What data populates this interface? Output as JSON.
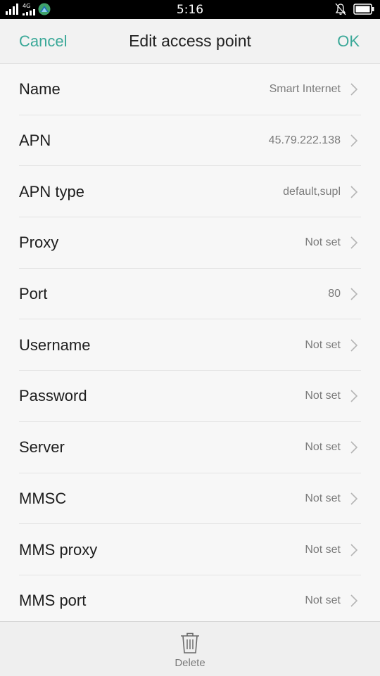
{
  "status_bar": {
    "time": "5:16",
    "network_label": "4G",
    "battery_icon": "battery-icon",
    "notif_icon": "bell-off-icon"
  },
  "header": {
    "cancel_label": "Cancel",
    "title": "Edit access point",
    "ok_label": "OK",
    "accent_color": "#3aa898"
  },
  "fields": [
    {
      "label": "Name",
      "value": "Smart Internet"
    },
    {
      "label": "APN",
      "value": "45.79.222.138"
    },
    {
      "label": "APN type",
      "value": "default,supl"
    },
    {
      "label": "Proxy",
      "value": "Not set"
    },
    {
      "label": "Port",
      "value": "80"
    },
    {
      "label": "Username",
      "value": "Not set"
    },
    {
      "label": "Password",
      "value": "Not set"
    },
    {
      "label": "Server",
      "value": "Not set"
    },
    {
      "label": "MMSC",
      "value": "Not set"
    },
    {
      "label": "MMS proxy",
      "value": "Not set"
    },
    {
      "label": "MMS port",
      "value": "Not set"
    }
  ],
  "bottom_bar": {
    "delete_label": "Delete"
  }
}
